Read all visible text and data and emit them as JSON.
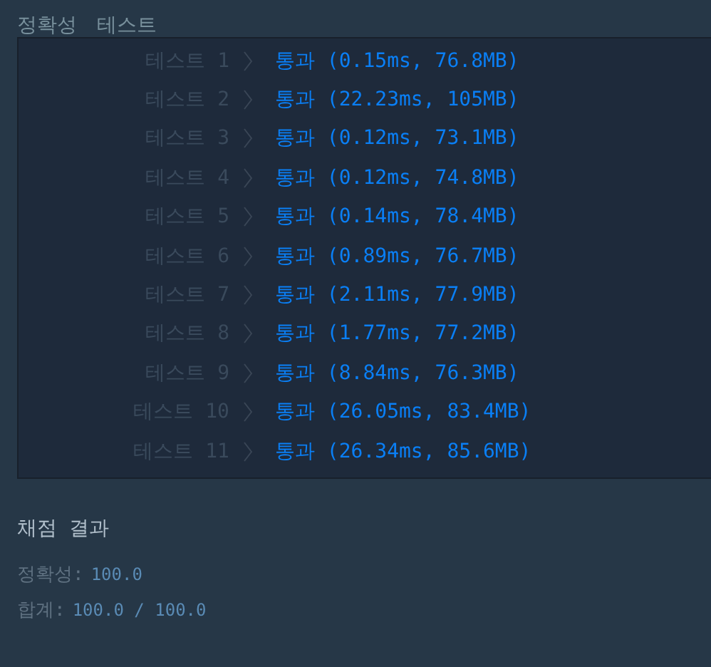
{
  "heading": {
    "section": "정확성",
    "title": "테스트"
  },
  "tests": [
    {
      "label": "테스트 1",
      "result": "통과 (0.15ms, 76.8MB)"
    },
    {
      "label": "테스트 2",
      "result": "통과 (22.23ms, 105MB)"
    },
    {
      "label": "테스트 3",
      "result": "통과 (0.12ms, 73.1MB)"
    },
    {
      "label": "테스트 4",
      "result": "통과 (0.12ms, 74.8MB)"
    },
    {
      "label": "테스트 5",
      "result": "통과 (0.14ms, 78.4MB)"
    },
    {
      "label": "테스트 6",
      "result": "통과 (0.89ms, 76.7MB)"
    },
    {
      "label": "테스트 7",
      "result": "통과 (2.11ms, 77.9MB)"
    },
    {
      "label": "테스트 8",
      "result": "통과 (1.77ms, 77.2MB)"
    },
    {
      "label": "테스트 9",
      "result": "통과 (8.84ms, 76.3MB)"
    },
    {
      "label": "테스트 10",
      "result": "통과 (26.05ms, 83.4MB)"
    },
    {
      "label": "테스트 11",
      "result": "통과 (26.34ms, 85.6MB)"
    }
  ],
  "summary": {
    "title": "채점 결과",
    "lines": [
      {
        "label": "정확성:",
        "value": "100.0"
      },
      {
        "label": "합계:",
        "value": "100.0 / 100.0"
      }
    ]
  }
}
